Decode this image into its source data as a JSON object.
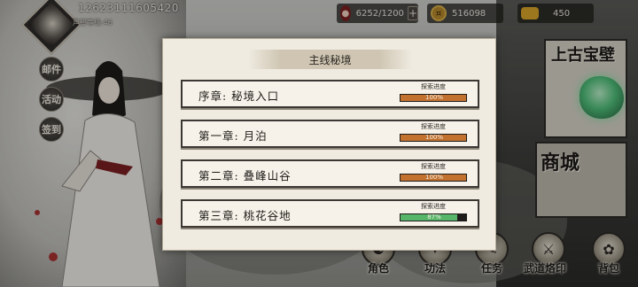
{
  "player": {
    "id": "12623111605420",
    "prestige": "声望等级:46"
  },
  "resources": {
    "stamina": {
      "value": "6252/1200",
      "icon": "blood-drop-icon"
    },
    "coins": {
      "value": "516098",
      "icon": "coin-icon"
    },
    "ingots": {
      "value": "450",
      "icon": "gold-ingot-icon"
    }
  },
  "side_menu": [
    "邮件",
    "活动",
    "签到"
  ],
  "right_panels": {
    "upper": "上古宝壁",
    "shop": "商城"
  },
  "bottom_menu": [
    {
      "label": "角色",
      "icon": "character-icon"
    },
    {
      "label": "功法",
      "icon": "skill-icon"
    },
    {
      "label": "任务",
      "icon": "quest-icon"
    },
    {
      "label": "武道烙印",
      "icon": "seal-icon"
    },
    {
      "label": "背包",
      "icon": "bag-icon"
    }
  ],
  "modal": {
    "title": "主线秘境",
    "progress_caption": "探索进度",
    "colors": {
      "complete": "#c2712f",
      "partial": "#57b56a"
    },
    "chapters": [
      {
        "name": "序章: 秘境入口",
        "progress_text": "100%",
        "progress": 1.0,
        "status": "complete"
      },
      {
        "name": "第一章: 月泊",
        "progress_text": "100%",
        "progress": 1.0,
        "status": "complete"
      },
      {
        "name": "第二章: 叠峰山谷",
        "progress_text": "100%",
        "progress": 1.0,
        "status": "complete"
      },
      {
        "name": "第三章: 桃花谷地",
        "progress_text": "87%",
        "progress": 0.87,
        "status": "partial"
      }
    ]
  }
}
